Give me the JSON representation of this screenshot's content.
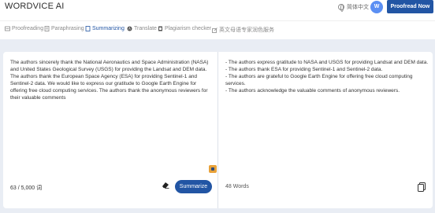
{
  "header": {
    "logo": "WORDVICE AI",
    "language": "简体中文",
    "avatar_initials": "W",
    "proofread_label": "Proofread Now"
  },
  "nav": {
    "items": [
      {
        "label": "Proofreading",
        "icon": "pencil-icon",
        "active": false
      },
      {
        "label": "Paraphrasing",
        "icon": "document-icon",
        "active": false
      },
      {
        "label": "Summarizing",
        "icon": "summary-icon",
        "active": true
      },
      {
        "label": "Translate",
        "icon": "translate-icon",
        "active": false
      },
      {
        "label": "Plagiarism checker",
        "icon": "plagiarism-icon",
        "active": false
      },
      {
        "label": "英文母语专家润色服务",
        "icon": "external-link-icon",
        "active": false
      }
    ]
  },
  "input": {
    "text": "The authors sincerely thank the National Aeronautics and Space Administration (NASA) and United States Geological Survey (USGS) for providing the Landsat and DEM data. The authors thank the European Space Agency (ESA) for providing Sentinel-1 and Sentinel-2 data. We would like to express our gratitude to Google Earth Engine for offering free cloud computing services. The authors thank the anonymous reviewers for their valuable comments",
    "count": "63 / 5,000 词",
    "summarize_label": "Summarize"
  },
  "output": {
    "bullets": [
      "- The authors express gratitude to NASA and USGS for providing Landsat and DEM data.",
      "- The authors thank ESA for providing Sentinel-1 and Sentinel-2 data.",
      "- The authors are grateful to Google Earth Engine for offering free cloud computing services.",
      "- The authors acknowledge the valuable comments of anonymous reviewers."
    ],
    "word_count": "48 Words"
  },
  "colors": {
    "accent": "#2255a4",
    "workspace_bg": "#e9edf4"
  }
}
